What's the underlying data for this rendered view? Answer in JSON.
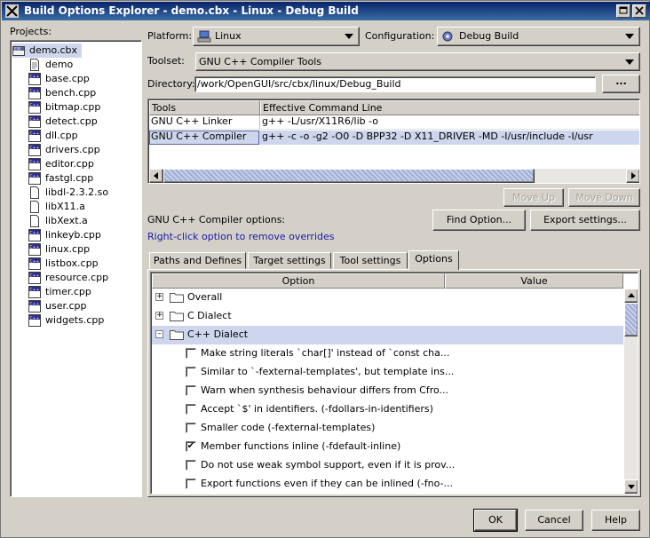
{
  "window": {
    "title": "Build Options Explorer - demo.cbx - Linux - Debug Build"
  },
  "projects": {
    "label": "Projects:",
    "root": "demo.cbx",
    "items": [
      {
        "name": "demo",
        "kind": "doc"
      },
      {
        "name": "base.cpp",
        "kind": "cpp"
      },
      {
        "name": "bench.cpp",
        "kind": "cpp"
      },
      {
        "name": "bitmap.cpp",
        "kind": "cpp"
      },
      {
        "name": "detect.cpp",
        "kind": "cpp"
      },
      {
        "name": "dll.cpp",
        "kind": "cpp"
      },
      {
        "name": "drivers.cpp",
        "kind": "cpp"
      },
      {
        "name": "editor.cpp",
        "kind": "cpp"
      },
      {
        "name": "fastgl.cpp",
        "kind": "cpp"
      },
      {
        "name": "libdl-2.3.2.so",
        "kind": "lib"
      },
      {
        "name": "libX11.a",
        "kind": "lib"
      },
      {
        "name": "libXext.a",
        "kind": "lib"
      },
      {
        "name": "linkeyb.cpp",
        "kind": "cpp"
      },
      {
        "name": "linux.cpp",
        "kind": "cpp"
      },
      {
        "name": "listbox.cpp",
        "kind": "cpp"
      },
      {
        "name": "resource.cpp",
        "kind": "cpp"
      },
      {
        "name": "timer.cpp",
        "kind": "cpp"
      },
      {
        "name": "user.cpp",
        "kind": "cpp"
      },
      {
        "name": "widgets.cpp",
        "kind": "cpp"
      }
    ]
  },
  "platform": {
    "label": "Platform:",
    "value": "Linux"
  },
  "configuration": {
    "label": "Configuration:",
    "value": "Debug Build"
  },
  "toolset": {
    "label": "Toolset:",
    "value": "GNU C++ Compiler Tools"
  },
  "directory": {
    "label": "Directory:",
    "value": "/work/OpenGUI/src/cbx/linux/Debug_Build",
    "browse_label": "..."
  },
  "tools_table": {
    "headers": [
      "Tools",
      "Effective Command Line"
    ],
    "rows": [
      {
        "tool": "GNU C++ Linker",
        "cmd": "g++ -L/usr/X11R6/lib -o"
      },
      {
        "tool": "GNU C++ Compiler",
        "cmd": "g++ -c -o -g2 -O0 -D BPP32 -D X11_DRIVER -MD -I/usr/include -I/usr"
      }
    ]
  },
  "move_up_label": "Move Up",
  "move_down_label": "Move Down",
  "options_title": "GNU C++ Compiler options:",
  "hint": "Right-click option to remove overrides",
  "find_option_label": "Find Option...",
  "export_settings_label": "Export settings...",
  "tabs": [
    {
      "label": "Paths and Defines",
      "active": false
    },
    {
      "label": "Target settings",
      "active": false
    },
    {
      "label": "Tool settings",
      "active": false
    },
    {
      "label": "Options",
      "active": true
    }
  ],
  "options_grid": {
    "headers": [
      "Option",
      "Value"
    ],
    "groups": [
      {
        "label": "Overall",
        "expanded": false
      },
      {
        "label": "C Dialect",
        "expanded": false
      },
      {
        "label": "C++ Dialect",
        "expanded": true
      }
    ],
    "options": [
      {
        "label": "Make string literals `char[]' instead of `const cha...",
        "checked": false
      },
      {
        "label": "Similar to `-fexternal-templates', but template ins...",
        "checked": false
      },
      {
        "label": "Warn when synthesis behaviour differs from Cfro...",
        "checked": false
      },
      {
        "label": "Accept `$' in identifiers. (-fdollars-in-identifiers)",
        "checked": false
      },
      {
        "label": "Smaller code (-fexternal-templates)",
        "checked": false
      },
      {
        "label": "Member functions inline (-fdefault-inline)",
        "checked": true
      },
      {
        "label": "Do not use weak symbol support, even if it is prov...",
        "checked": false
      },
      {
        "label": "Export functions even if they can be inlined (-fno-...",
        "checked": false
      }
    ]
  },
  "buttons": {
    "ok": "OK",
    "cancel": "Cancel",
    "help": "Help"
  },
  "colors": {
    "title_start": "#0a246a",
    "title_end": "#3a6ea5",
    "hint": "#1a1aa6",
    "selection": "#cdd6ec",
    "face": "#d4d0c8"
  }
}
